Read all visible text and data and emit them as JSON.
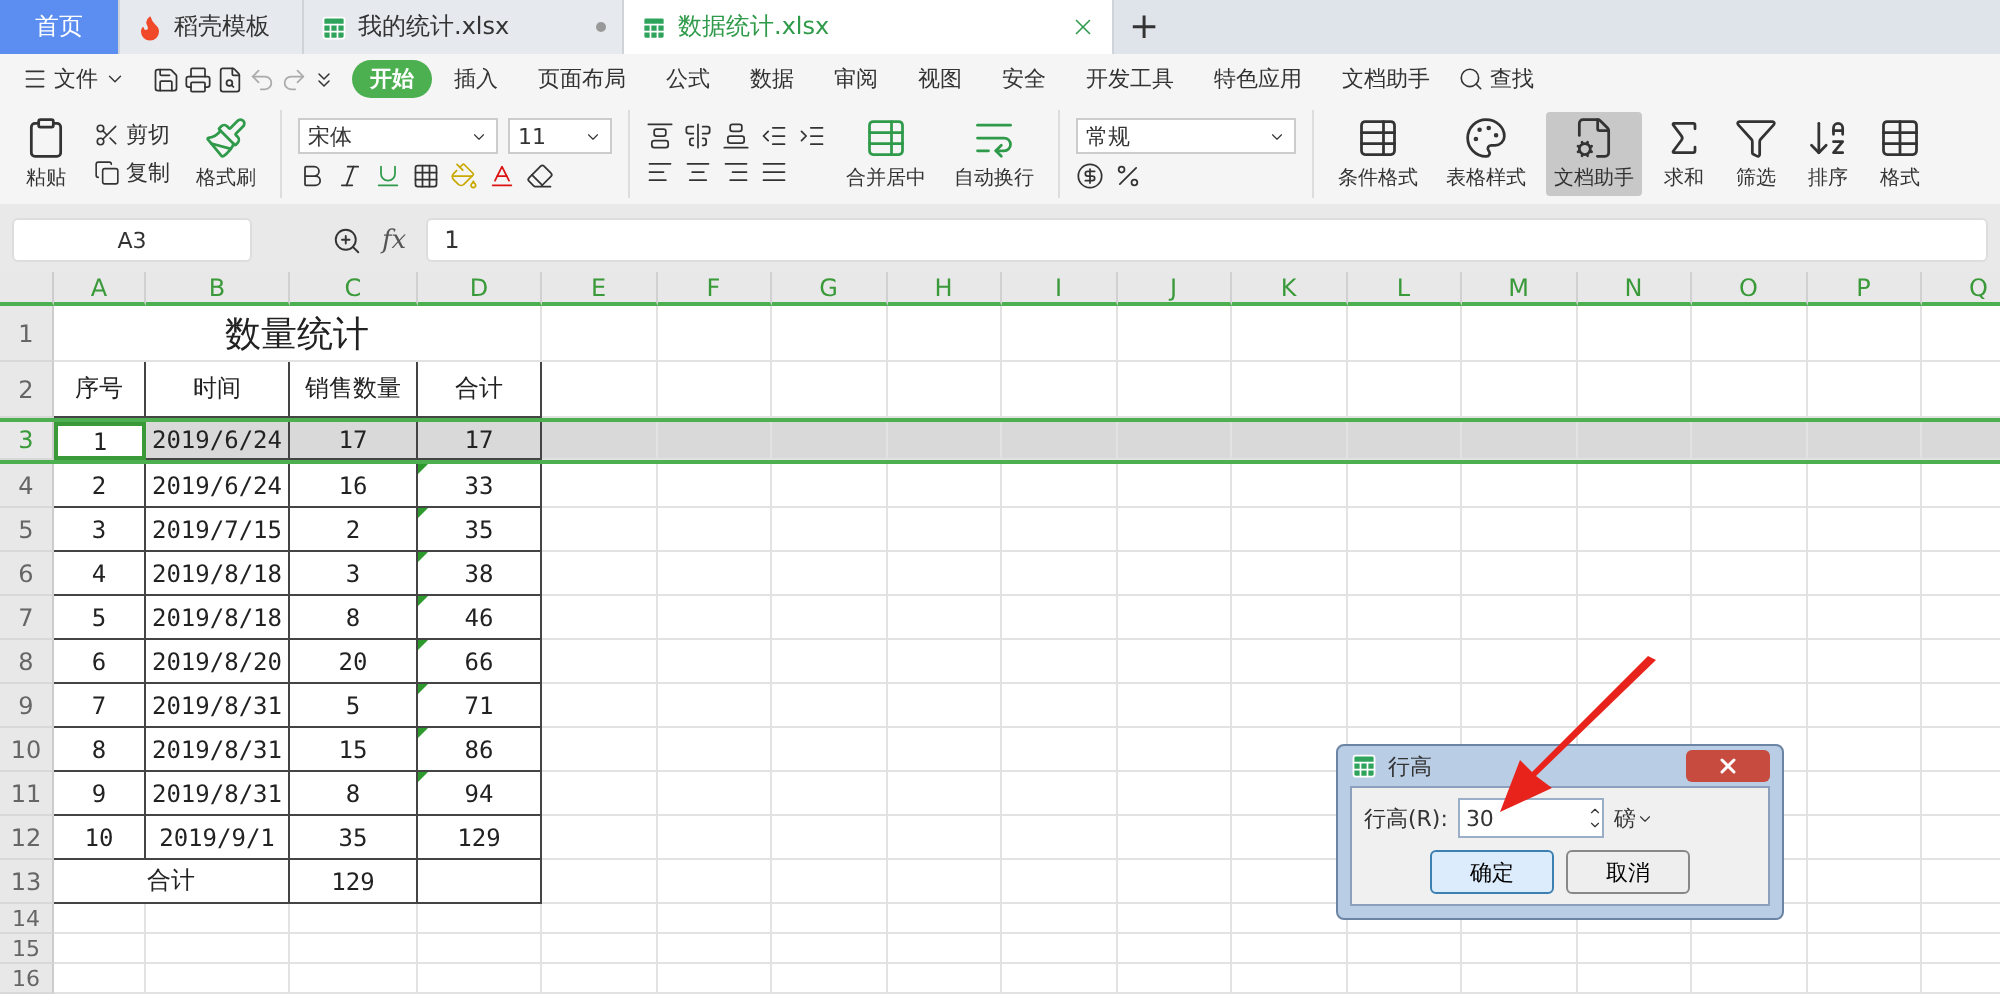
{
  "tabs": [
    {
      "label": "首页",
      "kind": "home",
      "selected": false
    },
    {
      "label": "稻壳模板",
      "kind": "docer",
      "selected": false
    },
    {
      "label": "我的统计.xlsx",
      "kind": "sheet",
      "selected": false
    },
    {
      "label": "数据统计.xlsx",
      "kind": "sheet",
      "selected": true
    }
  ],
  "new_tab": "+",
  "menu": {
    "file": "文件",
    "items": [
      {
        "label": "开始",
        "selected": true
      },
      {
        "label": "插入",
        "selected": false
      },
      {
        "label": "页面布局",
        "selected": false
      },
      {
        "label": "公式",
        "selected": false
      },
      {
        "label": "数据",
        "selected": false
      },
      {
        "label": "审阅",
        "selected": false
      },
      {
        "label": "视图",
        "selected": false
      },
      {
        "label": "安全",
        "selected": false
      },
      {
        "label": "开发工具",
        "selected": false
      },
      {
        "label": "特色应用",
        "selected": false
      },
      {
        "label": "文档助手",
        "selected": false
      }
    ],
    "search": "查找"
  },
  "ribbon": {
    "paste": "粘贴",
    "cut": "剪切",
    "copy": "复制",
    "format_painter": "格式刷",
    "font_name": "宋体",
    "font_size": "11",
    "merge": "合并居中",
    "wrap": "自动换行",
    "number_format": "常规",
    "right_buttons": [
      {
        "label": "条件格式",
        "selected": false
      },
      {
        "label": "表格样式",
        "selected": false
      },
      {
        "label": "文档助手",
        "selected": true
      },
      {
        "label": "求和",
        "selected": false
      },
      {
        "label": "筛选",
        "selected": false
      },
      {
        "label": "排序",
        "selected": false
      },
      {
        "label": "格式",
        "selected": false
      }
    ]
  },
  "name_box": "A3",
  "function_label": "fx",
  "formula": "1",
  "columns": [
    "A",
    "B",
    "C",
    "D",
    "E",
    "F",
    "G",
    "H",
    "I",
    "J",
    "K",
    "L",
    "M",
    "N",
    "O",
    "P",
    "Q"
  ],
  "rows": [
    {
      "number": "1",
      "kind": "title",
      "selected": false,
      "cells": [
        "数量统计"
      ]
    },
    {
      "number": "2",
      "kind": "header",
      "selected": false,
      "cells": [
        "序号",
        "时间",
        "销售数量",
        "合计"
      ]
    },
    {
      "number": "3",
      "kind": "data",
      "selected": true,
      "flagged": false,
      "cells": [
        "1",
        "2019/6/24",
        "17",
        "17"
      ]
    },
    {
      "number": "4",
      "kind": "data",
      "selected": false,
      "flagged": true,
      "cells": [
        "2",
        "2019/6/24",
        "16",
        "33"
      ]
    },
    {
      "number": "5",
      "kind": "data",
      "selected": false,
      "flagged": true,
      "cells": [
        "3",
        "2019/7/15",
        "2",
        "35"
      ]
    },
    {
      "number": "6",
      "kind": "data",
      "selected": false,
      "flagged": true,
      "cells": [
        "4",
        "2019/8/18",
        "3",
        "38"
      ]
    },
    {
      "number": "7",
      "kind": "data",
      "selected": false,
      "flagged": true,
      "cells": [
        "5",
        "2019/8/18",
        "8",
        "46"
      ]
    },
    {
      "number": "8",
      "kind": "data",
      "selected": false,
      "flagged": true,
      "cells": [
        "6",
        "2019/8/20",
        "20",
        "66"
      ]
    },
    {
      "number": "9",
      "kind": "data",
      "selected": false,
      "flagged": true,
      "cells": [
        "7",
        "2019/8/31",
        "5",
        "71"
      ]
    },
    {
      "number": "10",
      "kind": "data",
      "selected": false,
      "flagged": true,
      "cells": [
        "8",
        "2019/8/31",
        "15",
        "86"
      ]
    },
    {
      "number": "11",
      "kind": "data",
      "selected": false,
      "flagged": true,
      "cells": [
        "9",
        "2019/8/31",
        "8",
        "94"
      ]
    },
    {
      "number": "12",
      "kind": "data",
      "selected": false,
      "flagged": false,
      "cells": [
        "10",
        "2019/9/1",
        "35",
        "129"
      ]
    },
    {
      "number": "13",
      "kind": "total",
      "selected": false,
      "cells": [
        "合计",
        "129",
        ""
      ]
    },
    {
      "number": "14",
      "kind": "empty",
      "selected": false
    },
    {
      "number": "15",
      "kind": "empty",
      "selected": false
    },
    {
      "number": "16",
      "kind": "empty",
      "selected": false
    }
  ],
  "dialog": {
    "title": "行高",
    "label": "行高(R):",
    "value": "30",
    "unit": "磅",
    "buttons": [
      "确定",
      "取消"
    ]
  }
}
